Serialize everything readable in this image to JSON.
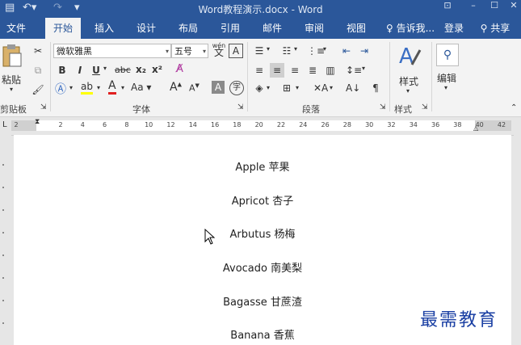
{
  "title_bar": {
    "title": "Word教程演示.docx - Word"
  },
  "tabs": [
    {
      "label": "文件"
    },
    {
      "label": "开始"
    },
    {
      "label": "插入"
    },
    {
      "label": "设计"
    },
    {
      "label": "布局"
    },
    {
      "label": "引用"
    },
    {
      "label": "邮件"
    },
    {
      "label": "审阅"
    },
    {
      "label": "视图"
    }
  ],
  "tell_me": "告诉我...",
  "sign_in": "登录",
  "share": "共享",
  "clipboard": {
    "paste_label": "粘贴",
    "group_label": "剪贴板"
  },
  "font": {
    "name": "微软雅黑",
    "size": "五号",
    "group_label": "字体",
    "bold": "B",
    "italic": "I",
    "underline": "U",
    "strike": "abc",
    "subscript": "x₂",
    "superscript": "x²",
    "case": "Aa",
    "grow": "A",
    "shrink": "A",
    "shade": "A",
    "enclose": "字",
    "phonetic": "wén",
    "phonetic_char": "文"
  },
  "paragraph": {
    "group_label": "段落"
  },
  "styles": {
    "label": "样式",
    "group_label": "样式"
  },
  "editing": {
    "label": "编辑"
  },
  "ruler": {
    "ticks": [
      "2",
      "2",
      "4",
      "6",
      "8",
      "10",
      "12",
      "14",
      "16",
      "18",
      "20",
      "22",
      "24",
      "26",
      "28",
      "30",
      "32",
      "34",
      "36",
      "38",
      "40",
      "42"
    ]
  },
  "document": {
    "lines": [
      "Apple 苹果",
      "Apricot 杏子",
      "Arbutus 杨梅",
      "Avocado 南美梨",
      "Bagasse 甘蔗渣",
      "Banana 香蕉"
    ]
  },
  "watermark": "最需教育",
  "colors": {
    "brand": "#2b579a",
    "ribbon": "#f3f3f3",
    "watermark": "#1a3fa3"
  }
}
